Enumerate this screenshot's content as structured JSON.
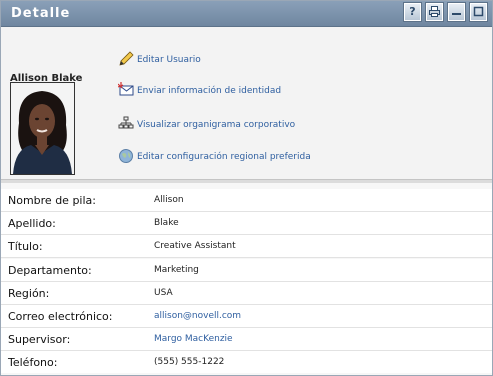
{
  "window": {
    "title": "Detalle",
    "buttons": {
      "help": "?"
    }
  },
  "user": {
    "display_name": "Allison Blake"
  },
  "actions": [
    {
      "label": "Editar Usuario",
      "icon": "pencil-icon"
    },
    {
      "label": "Enviar información de identidad",
      "icon": "envelope-icon"
    },
    {
      "label": "Visualizar organigrama corporativo",
      "icon": "org-chart-icon"
    },
    {
      "label": "Editar configuración regional preferida",
      "icon": "globe-icon"
    }
  ],
  "fields": [
    {
      "label": "Nombre de pila:",
      "value": "Allison",
      "link": false
    },
    {
      "label": "Apellido:",
      "value": "Blake",
      "link": false
    },
    {
      "label": "Título:",
      "value": "Creative Assistant",
      "link": false
    },
    {
      "label": "Departamento:",
      "value": "Marketing",
      "link": false
    },
    {
      "label": "Región:",
      "value": "USA",
      "link": false
    },
    {
      "label": "Correo electrónico:",
      "value": "allison@novell.com",
      "link": true
    },
    {
      "label": "Supervisor:",
      "value": "Margo MacKenzie",
      "link": true
    },
    {
      "label": "Teléfono:",
      "value": "(555) 555-1222",
      "link": false
    }
  ],
  "colors": {
    "titlebar": "#7a90a9",
    "link": "#2f5fa0"
  }
}
